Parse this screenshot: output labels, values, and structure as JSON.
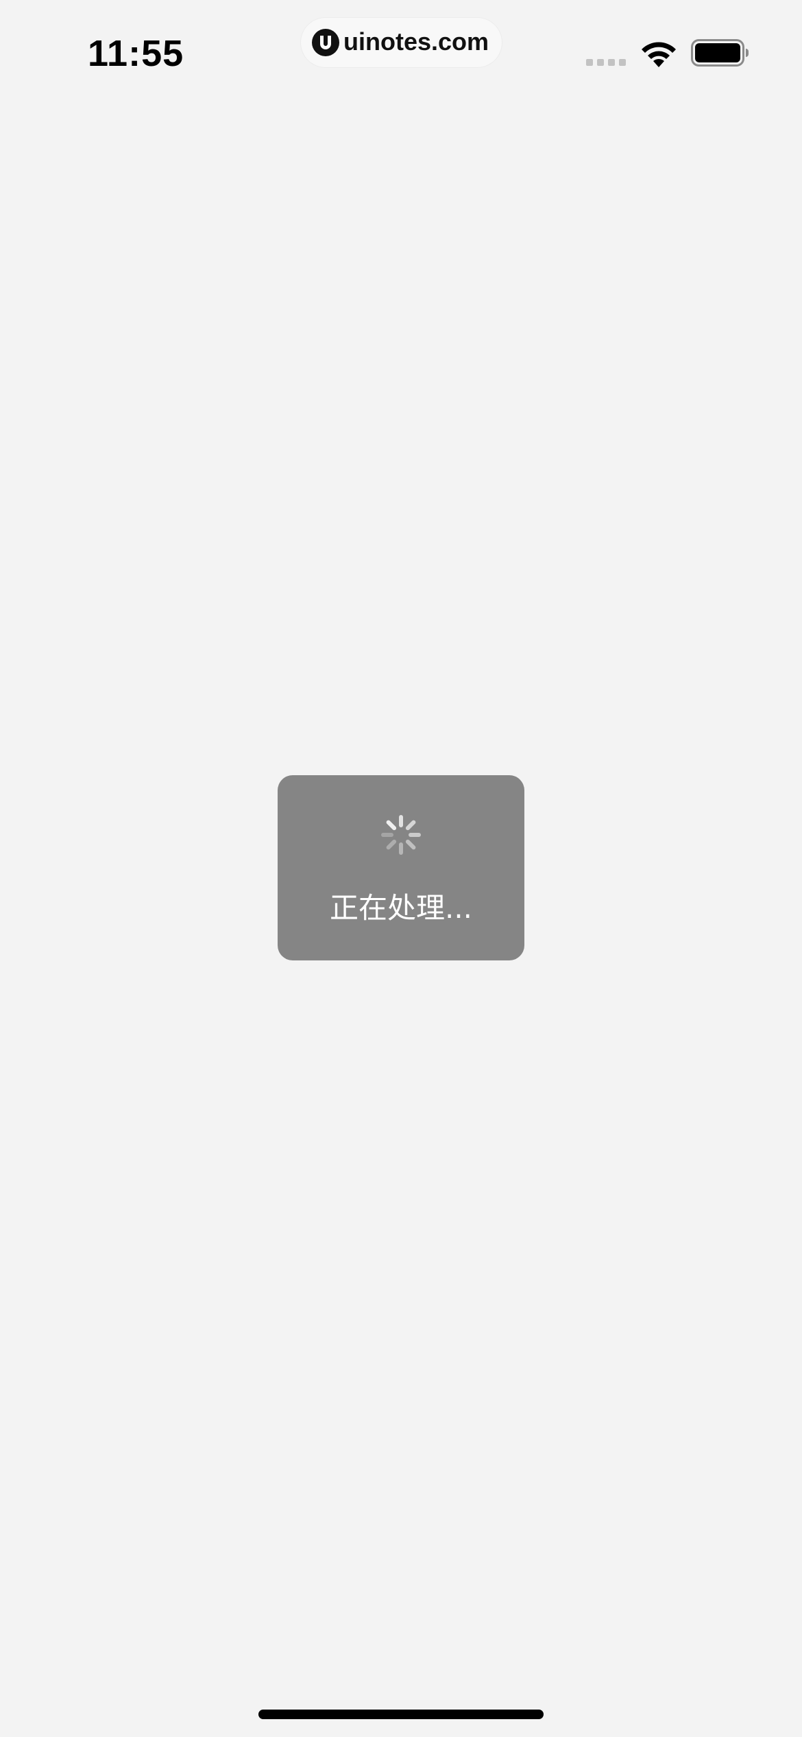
{
  "status_bar": {
    "time": "11:55",
    "url": "uinotes.com",
    "icons": [
      "signal-dots-icon",
      "wifi-icon",
      "battery-icon"
    ]
  },
  "toast": {
    "spinner_icon": "loading-spinner-icon",
    "message": "正在处理..."
  },
  "colors": {
    "background": "#f3f3f3",
    "toast_background": "#858585",
    "toast_text": "#ffffff",
    "status_text": "#000000"
  }
}
